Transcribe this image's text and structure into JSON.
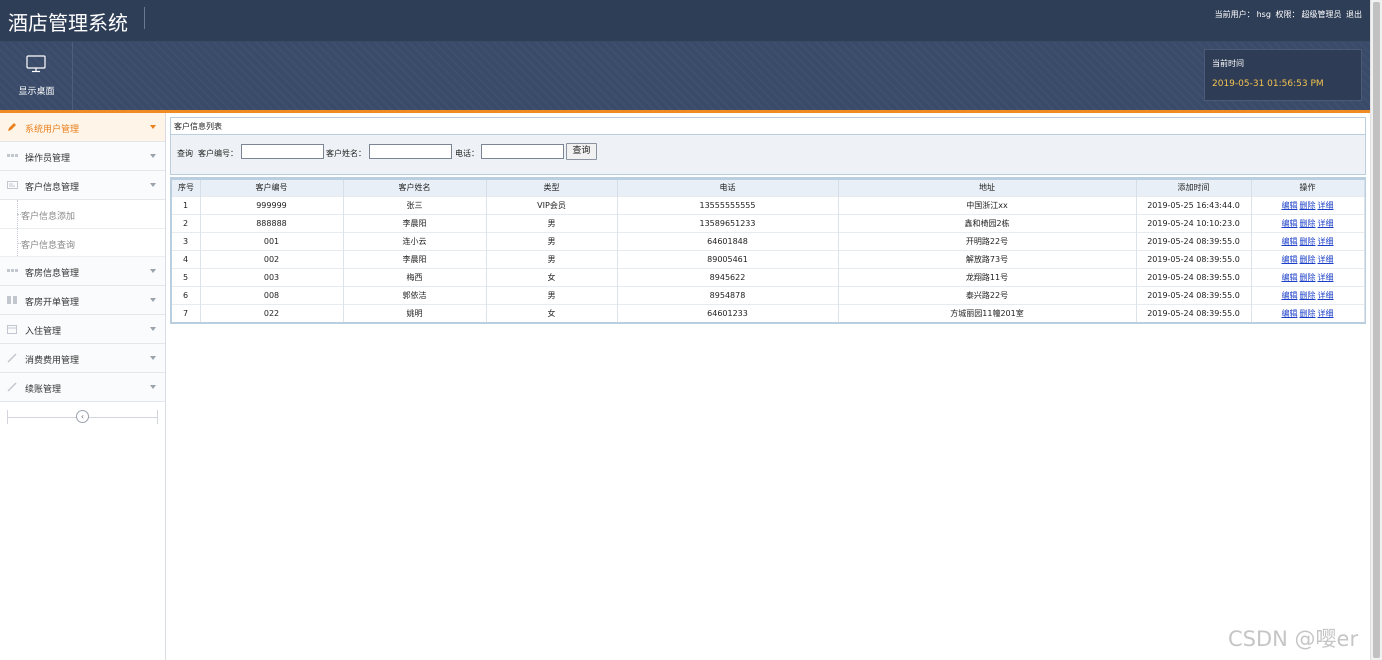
{
  "header": {
    "title": "酒店管理系统",
    "user_label": "当前用户：",
    "user_name": "hsg",
    "role_label": "权限：",
    "role_name": "超级管理员",
    "logout": "退出"
  },
  "toolbar": {
    "desktop_label": "显示桌面",
    "time_label": "当前时间",
    "time_value": "2019-05-31 01:56:53 PM"
  },
  "sidebar": {
    "items": [
      {
        "label": "系统用户管理",
        "icon": "pencil-icon",
        "active": true
      },
      {
        "label": "操作员管理",
        "icon": "grid-icon"
      },
      {
        "label": "客户信息管理",
        "icon": "card-icon"
      },
      {
        "label": "客房信息管理",
        "icon": "grid-icon"
      },
      {
        "label": "客房开单管理",
        "icon": "columns-icon"
      },
      {
        "label": "入住管理",
        "icon": "calendar-icon"
      },
      {
        "label": "消费费用管理",
        "icon": "pen-icon"
      },
      {
        "label": "续账管理",
        "icon": "pen-icon"
      }
    ],
    "sub_items": [
      "客户信息添加",
      "客户信息查询"
    ]
  },
  "panel": {
    "title": "客户信息列表"
  },
  "search": {
    "prefix": "查询",
    "customer_id_label": "客户编号：",
    "customer_name_label": "客户姓名：",
    "phone_label": "电话：",
    "customer_id_value": "",
    "customer_name_value": "",
    "phone_value": "",
    "button": "查询"
  },
  "table": {
    "headers": [
      "序号",
      "客户编号",
      "客户姓名",
      "类型",
      "电话",
      "地址",
      "添加时间",
      "操作"
    ],
    "actions": [
      "编辑",
      "删除",
      "详细"
    ],
    "rows": [
      [
        "1",
        "999999",
        "张三",
        "VIP会员",
        "13555555555",
        "中国浙江xx",
        "2019-05-25 16:43:44.0"
      ],
      [
        "2",
        "888888",
        "李晨阳",
        "男",
        "13589651233",
        "鑫和椅园2栋",
        "2019-05-24 10:10:23.0"
      ],
      [
        "3",
        "001",
        "连小云",
        "男",
        "64601848",
        "开明路22号",
        "2019-05-24 08:39:55.0"
      ],
      [
        "4",
        "002",
        "李晨阳",
        "男",
        "89005461",
        "解放路73号",
        "2019-05-24 08:39:55.0"
      ],
      [
        "5",
        "003",
        "梅西",
        "女",
        "8945622",
        "龙翔路11号",
        "2019-05-24 08:39:55.0"
      ],
      [
        "6",
        "008",
        "郭依洁",
        "男",
        "8954878",
        "泰兴路22号",
        "2019-05-24 08:39:55.0"
      ],
      [
        "7",
        "022",
        "姚明",
        "女",
        "64601233",
        "方城丽园11幢201室",
        "2019-05-24 08:39:55.0"
      ]
    ]
  },
  "watermark": "CSDN @嘤er"
}
